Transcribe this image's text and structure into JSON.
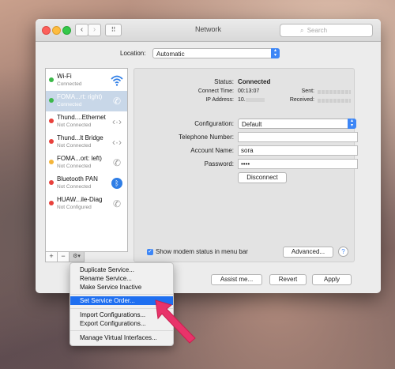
{
  "window": {
    "title": "Network",
    "search_placeholder": "Search"
  },
  "location": {
    "label": "Location:",
    "value": "Automatic"
  },
  "services": [
    {
      "name": "Wi-Fi",
      "status": "Connected",
      "color": "#3cb84a",
      "icon": "wifi-icon"
    },
    {
      "name": "FOMA...rt: right)",
      "status": "Connected",
      "color": "#3cb84a",
      "icon": "phone-icon",
      "selected": true
    },
    {
      "name": "Thund....Ethernet",
      "status": "Not Connected",
      "color": "#e8413c",
      "icon": "ethernet-icon"
    },
    {
      "name": "Thund...lt Bridge",
      "status": "Not Connected",
      "color": "#e8413c",
      "icon": "ethernet-icon"
    },
    {
      "name": "FOMA...ort: left)",
      "status": "Not Connected",
      "color": "#f4b53a",
      "icon": "phone-icon"
    },
    {
      "name": "Bluetooth PAN",
      "status": "Not Connected",
      "color": "#e8413c",
      "icon": "bluetooth-icon"
    },
    {
      "name": "HUAW...ile-Diag",
      "status": "Not Configured",
      "color": "#e8413c",
      "icon": "phone-icon"
    }
  ],
  "toolbar": {
    "add": "+",
    "remove": "−",
    "gear": "⚙▾"
  },
  "details": {
    "status_label": "Status:",
    "status_value": "Connected",
    "connect_time_label": "Connect Time:",
    "connect_time_value": "00:13:07",
    "ip_label": "IP Address:",
    "ip_value": "10.",
    "sent_label": "Sent:",
    "received_label": "Received:",
    "configuration_label": "Configuration:",
    "configuration_value": "Default",
    "telephone_label": "Telephone Number:",
    "telephone_value": "",
    "account_label": "Account Name:",
    "account_value": "sora",
    "password_label": "Password:",
    "password_value": "••••",
    "disconnect": "Disconnect",
    "modem_checkbox_label": "Show modem status in menu bar",
    "advanced": "Advanced...",
    "help": "?"
  },
  "footer": {
    "assist": "Assist me...",
    "revert": "Revert",
    "apply": "Apply"
  },
  "menu": {
    "items": [
      "Duplicate Service...",
      "Rename Service...",
      "Make Service Inactive",
      "Set Service Order...",
      "Import Configurations...",
      "Export Configurations...",
      "Manage Virtual Interfaces..."
    ],
    "highlighted": "Set Service Order..."
  },
  "colors": {
    "accent": "#3d86f6",
    "highlight": "#1f6ff0",
    "arrow": "#e8336a"
  }
}
